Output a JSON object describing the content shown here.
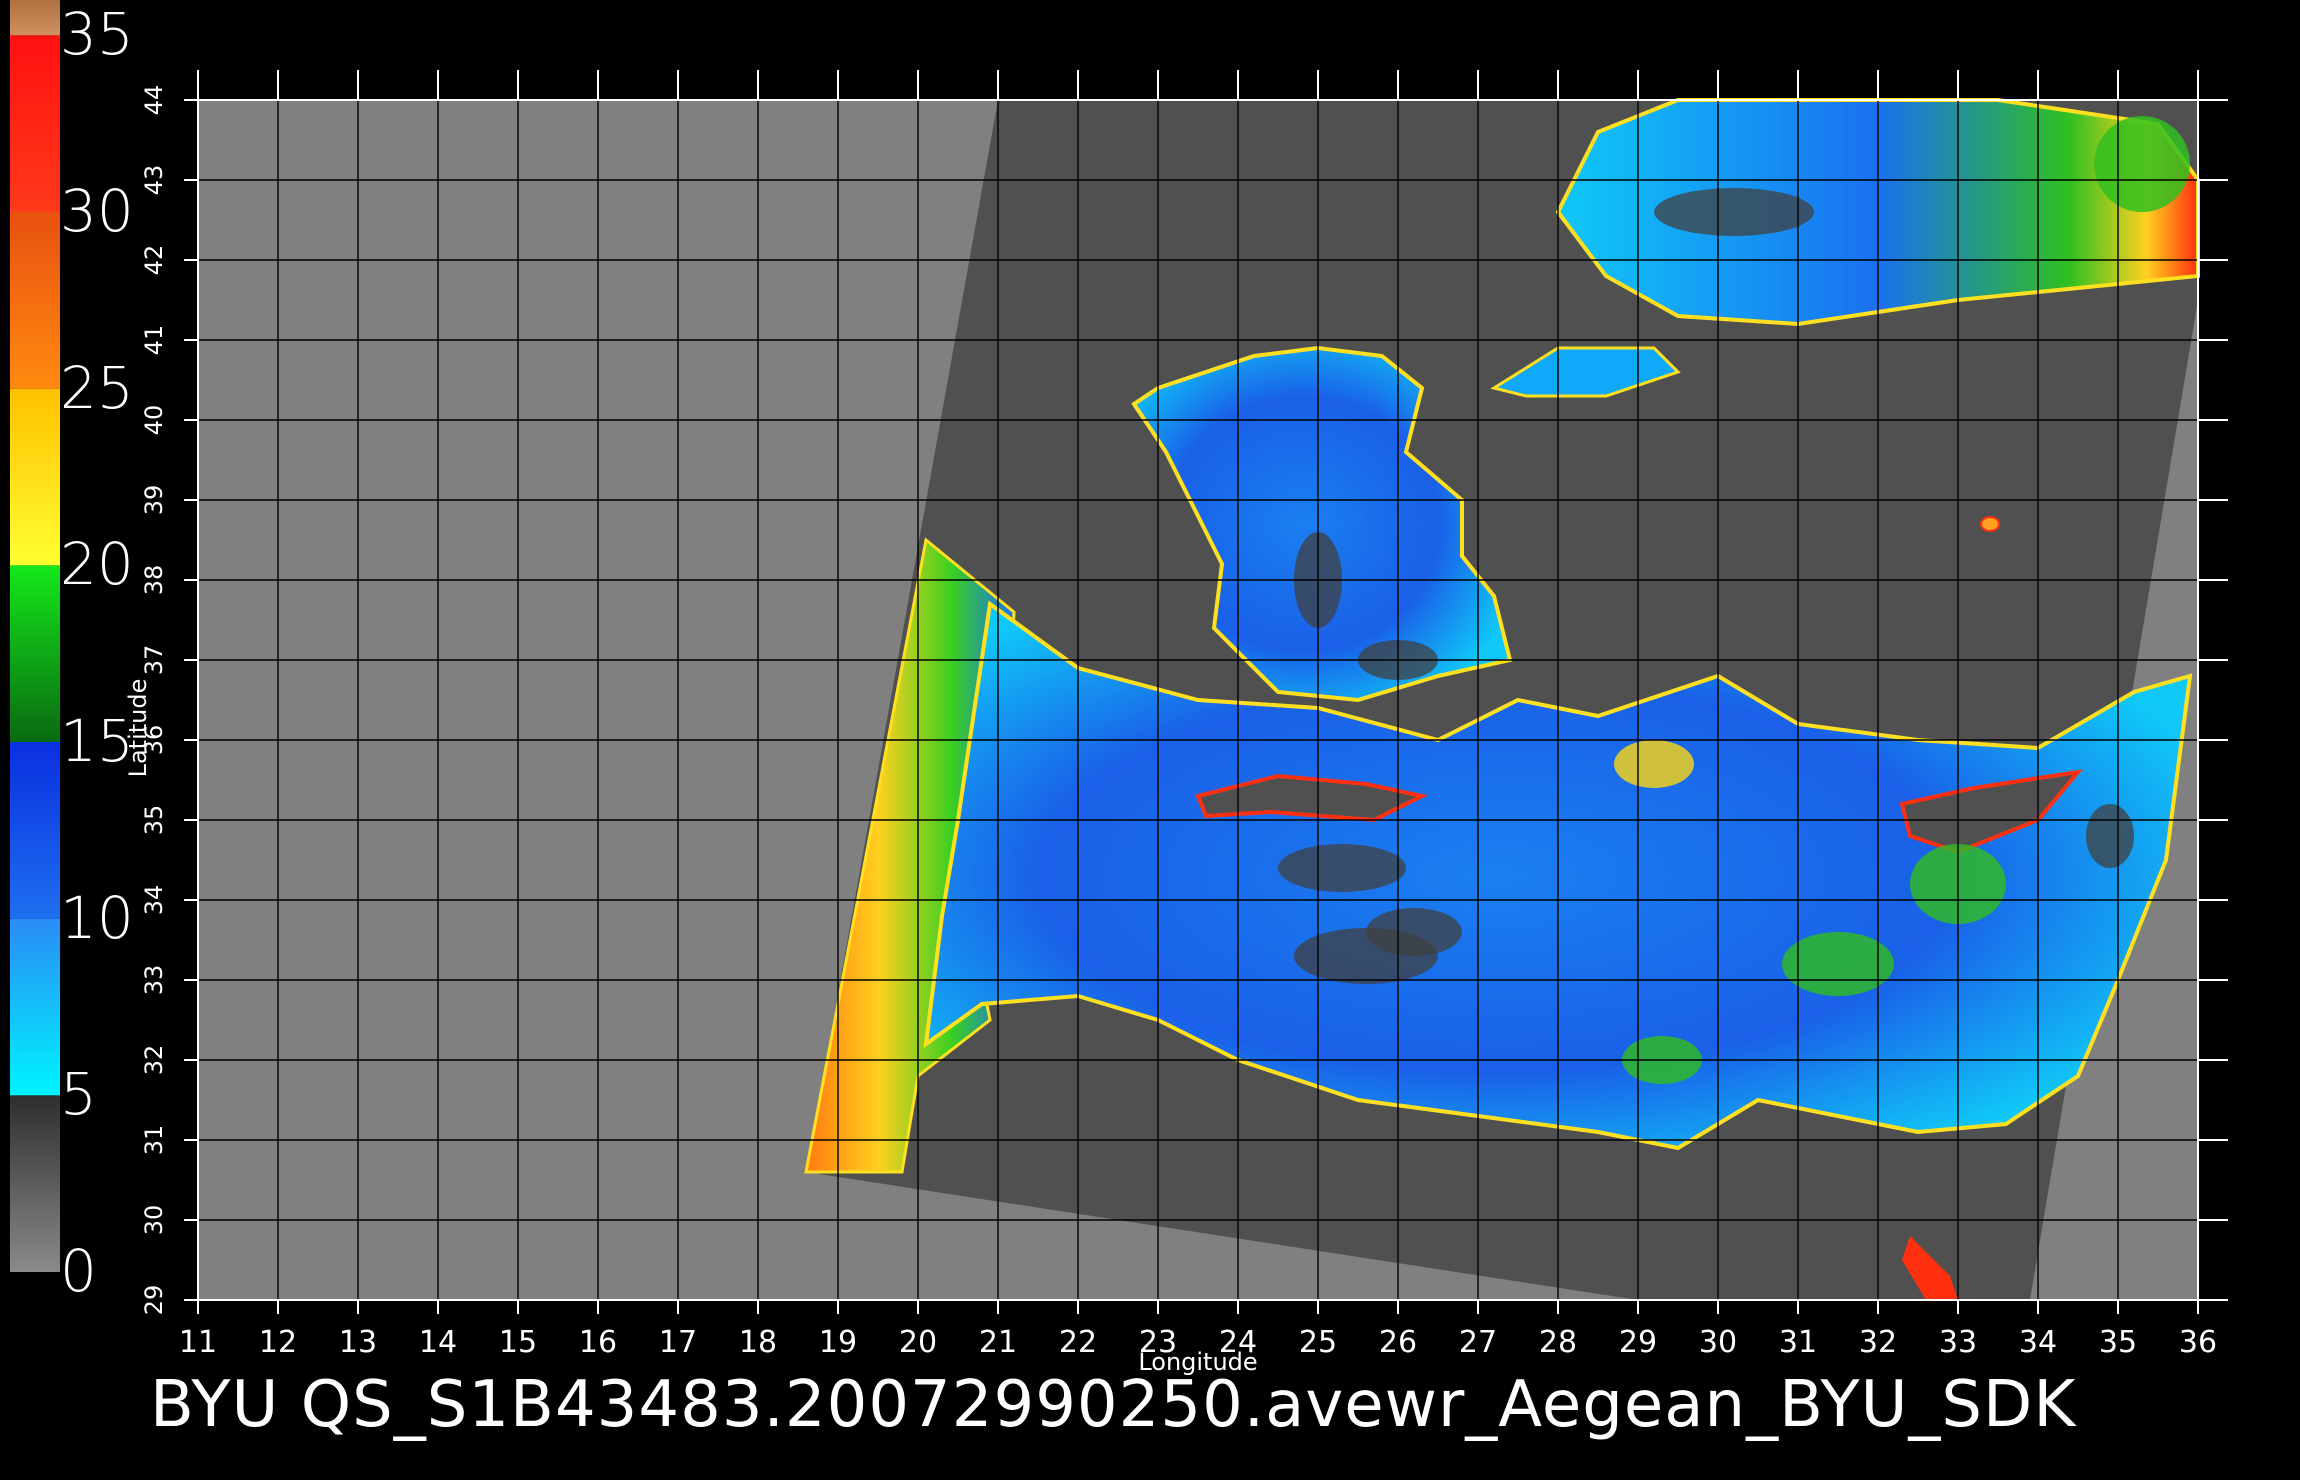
{
  "chart_data": {
    "type": "heatmap",
    "colorbar": {
      "tick_labels": [
        "35",
        "30",
        "25",
        "20",
        "15",
        "10",
        "5",
        "0"
      ],
      "segments": [
        {
          "from": 0,
          "to": 5,
          "colors": [
            "#8a8a8a",
            "#2e2e2e"
          ]
        },
        {
          "from": 5,
          "to": 10,
          "colors": [
            "#00f4ff",
            "#2a8cf5"
          ]
        },
        {
          "from": 10,
          "to": 15,
          "colors": [
            "#1e6ff0",
            "#0a2fe0"
          ]
        },
        {
          "from": 15,
          "to": 20,
          "colors": [
            "#0a6a12",
            "#14e81a"
          ]
        },
        {
          "from": 20,
          "to": 25,
          "colors": [
            "#ffff30",
            "#ffc000"
          ]
        },
        {
          "from": 25,
          "to": 30,
          "colors": [
            "#ff8a10",
            "#e85010"
          ]
        },
        {
          "from": 30,
          "to": 35,
          "colors": [
            "#ff3a1a",
            "#ff1010"
          ]
        },
        {
          "from": 35,
          "to": 36,
          "colors": [
            "#d09060",
            "#b07040"
          ]
        }
      ]
    },
    "x_axis": {
      "label": "Longitude",
      "ticks": [
        11,
        12,
        13,
        14,
        15,
        16,
        17,
        18,
        19,
        20,
        21,
        22,
        23,
        24,
        25,
        26,
        27,
        28,
        29,
        30,
        31,
        32,
        33,
        34,
        35,
        36
      ],
      "range": [
        11,
        36
      ]
    },
    "y_axis": {
      "label": "Latitude",
      "ticks": [
        29,
        30,
        31,
        32,
        33,
        34,
        35,
        36,
        37,
        38,
        39,
        40,
        41,
        42,
        43,
        44
      ],
      "range": [
        29,
        44
      ]
    },
    "colors": {
      "outside": "#808080",
      "land": "#505050",
      "sea_mid": "#1a8cf0"
    },
    "caption": "BYU  QS_S1B43483.20072990250.avewr_Aegean_BYU_SDK"
  }
}
